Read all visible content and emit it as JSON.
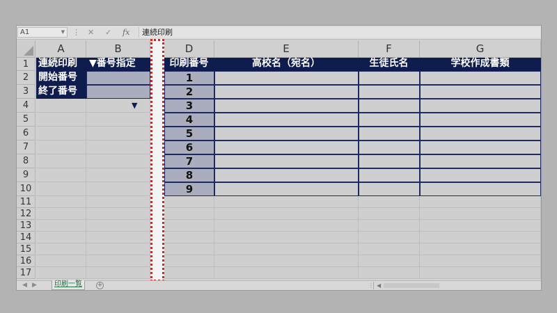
{
  "formula_bar": {
    "name_box": "A1",
    "cancel_glyph": "✕",
    "confirm_glyph": "✓",
    "fx_label": "fx",
    "formula": "連続印刷"
  },
  "columns": [
    "A",
    "B",
    "C",
    "D",
    "E",
    "F",
    "G"
  ],
  "rows": [
    "1",
    "2",
    "3",
    "4",
    "5",
    "6",
    "7",
    "8",
    "9",
    "10",
    "11",
    "12",
    "13",
    "14",
    "15",
    "16",
    "17"
  ],
  "cells": {
    "A1": "連続印刷",
    "B1": "▼番号指定",
    "A2": "開始番号",
    "A3": "終了番号",
    "B4": "▼",
    "D1": "印刷番号",
    "E1": "高校名（宛名）",
    "F1": "生徒氏名",
    "G1": "学校作成書類"
  },
  "print_numbers": [
    "1",
    "2",
    "3",
    "4",
    "5",
    "6",
    "7",
    "8",
    "9"
  ],
  "sheet_tabs": [
    "印刷一覧"
  ],
  "colors": {
    "header_navy": "#0f1c4e",
    "highlight_red": "#e02020"
  }
}
